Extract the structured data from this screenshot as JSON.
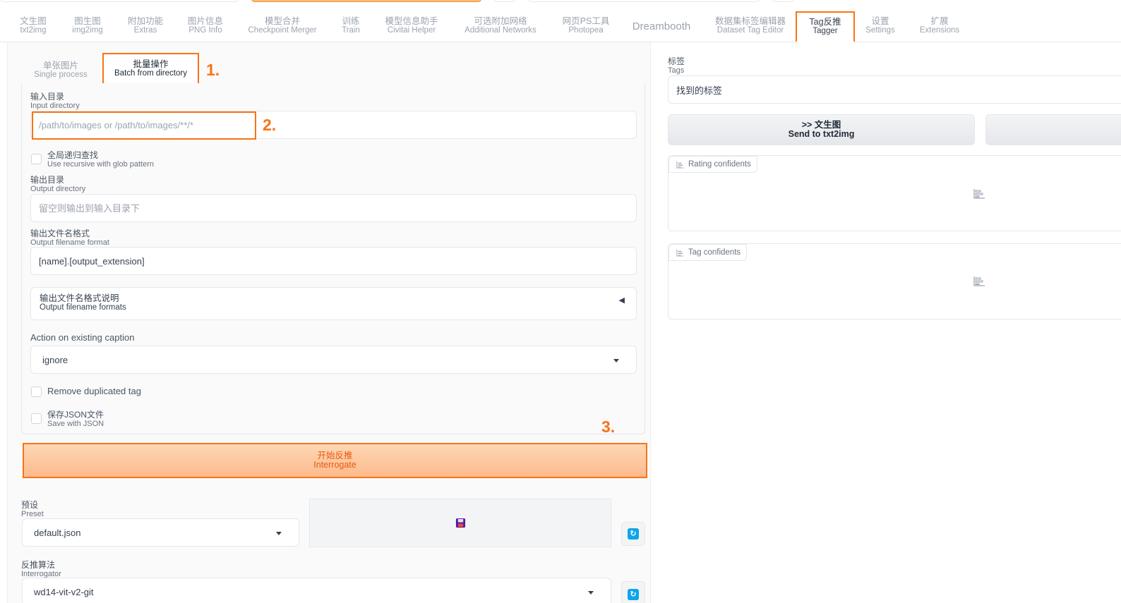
{
  "tabs": [
    {
      "label": "文生图",
      "sub": "txt2img"
    },
    {
      "label": "图生图",
      "sub": "img2img"
    },
    {
      "label": "附加功能",
      "sub": "Extras"
    },
    {
      "label": "图片信息",
      "sub": "PNG Info"
    },
    {
      "label": "模型合并",
      "sub": "Checkpoint Merger"
    },
    {
      "label": "训练",
      "sub": "Train"
    },
    {
      "label": "模型信息助手",
      "sub": "Civitai Helper"
    },
    {
      "label": "可选附加网络",
      "sub": "Additional Networks"
    },
    {
      "label": "网页PS工具",
      "sub": "Photopea"
    },
    {
      "label": "Dreambooth",
      "sub": ""
    },
    {
      "label": "数据集标签编辑器",
      "sub": "Dataset Tag Editor"
    },
    {
      "label": "Tag反推",
      "sub": "Tagger"
    },
    {
      "label": "设置",
      "sub": "Settings"
    },
    {
      "label": "扩展",
      "sub": "Extensions"
    }
  ],
  "subtabs": {
    "single": {
      "label": "单张图片",
      "sub": "Single process"
    },
    "batch": {
      "label": "批量操作",
      "sub": "Batch from directory"
    }
  },
  "form": {
    "input_dir": {
      "label": "输入目录",
      "sub": "Input directory",
      "placeholder": "/path/to/images or /path/to/images/**/*"
    },
    "recursive": {
      "label": "全局递归查找",
      "sub": "Use recursive with glob pattern"
    },
    "output_dir": {
      "label": "输出目录",
      "sub": "Output directory",
      "placeholder": "留空则输出到输入目录下"
    },
    "filename_format": {
      "label": "输出文件名格式",
      "sub": "Output filename format",
      "value": "[name].[output_extension]"
    },
    "formats_accordion": {
      "label": "输出文件名格式说明",
      "sub": "Output filename formats",
      "arrow": "◀"
    },
    "existing_caption": {
      "label": "Action on existing caption",
      "value": "ignore"
    },
    "remove_dup": {
      "label": "Remove duplicated tag"
    },
    "save_json": {
      "label": "保存JSON文件",
      "sub": "Save with JSON"
    }
  },
  "annotations": {
    "n1": "1.",
    "n2": "2.",
    "n3": "3."
  },
  "interrogate": {
    "label": "开始反推",
    "sub": "Interrogate"
  },
  "preset": {
    "label": "预设",
    "sub": "Preset",
    "value": "default.json"
  },
  "interrogator": {
    "label": "反推算法",
    "sub": "Interrogator",
    "value": "wd14-vit-v2-git"
  },
  "right": {
    "tags_label": "标签",
    "tags_sub": "Tags",
    "tags_placeholder": "找到的标签",
    "send_txt2img": ">> 文生图",
    "send_txt2img_sub": "Send to txt2img",
    "rating_label": "Rating confidents",
    "tag_label": "Tag confidents"
  },
  "colors": {
    "accent": "#f97316",
    "refresh": "#0ea5e9"
  }
}
